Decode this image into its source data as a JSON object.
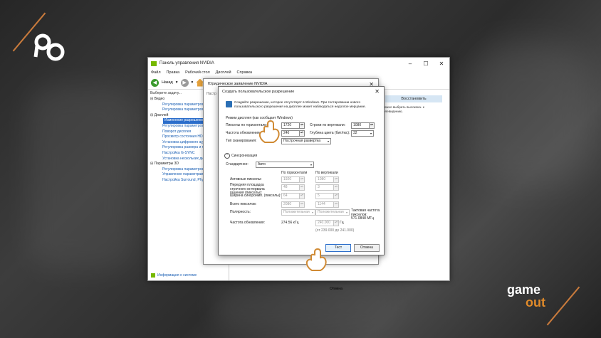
{
  "main_window": {
    "title": "Панель управления NVIDIA",
    "menu": [
      "Файл",
      "Правка",
      "Рабочий стол",
      "Дисплей",
      "Справка"
    ],
    "back_label": "Назад",
    "task_label": "Выберите задачу...",
    "tree": {
      "video": "Видео",
      "video_items": [
        "Регулировка параметров цв",
        "Регулировка параметров из"
      ],
      "display": "Дисплей",
      "display_selected": "Изменение разрешения",
      "display_items": [
        "Регулировка параметров цв",
        "Поворот дисплея",
        "Просмотр состояния HDCP",
        "Установка цифрового ауд",
        "Регулировка размера и по",
        "Настройка G-SYNC",
        "Установка нескольких дисп"
      ],
      "params3d": "Параметры 3D",
      "params3d_items": [
        "Регулировка параметров из",
        "Управление параметрами 3",
        "Настройка Surround, Physi"
      ]
    },
    "system_info": "Информация о системе",
    "restore_label": "Восстановить",
    "right_text": "Можно выбрать высокока- к телевидению."
  },
  "back_dialog": {
    "title": "Юридическое заявление NVIDIA",
    "side_text": "Настр"
  },
  "dialog": {
    "title": "Создать пользовательское разрешение",
    "info": "Создайте разрешение, которое отсутствует в Windows. При тестировании нового пользовательского разрешения на дисплее может наблюдаться недолгое мерцание.",
    "mode_label": "Режим дисплея (как сообщает Windows)",
    "h_pixels_label": "Пикселы по горизонтали:",
    "h_pixels_value": "1720",
    "v_lines_label": "Строки по вертикали:",
    "v_lines_value": "1080",
    "refresh_label": "Частота обновления",
    "refresh_value": "240",
    "color_depth_label": "Глубина цвета (бит/пкс):",
    "color_depth_value": "32",
    "scan_label": "Тип сканирования:",
    "scan_value": "Построчная развертка",
    "sync_label": "Синхронизация",
    "standard_label": "Стандартное:",
    "standard_value": "Авто",
    "col_h": "По горизонтали",
    "col_v": "По вертикали",
    "rows": [
      {
        "label": "Активные пикселы:",
        "h": "1920",
        "v": "1080"
      },
      {
        "label": "Передняя площадка строчного интервала гашения (пикселы):",
        "h": "48",
        "v": "3"
      },
      {
        "label": "Ширина синхроимп. (пикселы):",
        "h": "64",
        "v": "5"
      },
      {
        "label": "Всего пикселов:",
        "h": "2080",
        "v": "1144"
      }
    ],
    "polarity_label": "Полярность:",
    "polarity_h": "Положительная",
    "polarity_v": "Положительная",
    "pixel_clock_label": "Тактовая частота пикселов:",
    "pixel_clock_value": "571.0848 МГц",
    "refresh_rate_label": "Частота обновления:",
    "refresh_rate_h": "274.56 кГц",
    "refresh_rate_v": "240.000",
    "hz": "Гц",
    "range": "(от 239.000 до 241.000)",
    "test_button": "Тест",
    "cancel_button": "Отмена"
  },
  "under_buttons": {
    "btn2": "Отмена"
  },
  "brand_right": {
    "top": "game",
    "bottom": "out"
  },
  "colors": {
    "nvidia_green": "#76b900",
    "selection": "#2c6ecb",
    "accent_orange": "#e08a2a"
  }
}
